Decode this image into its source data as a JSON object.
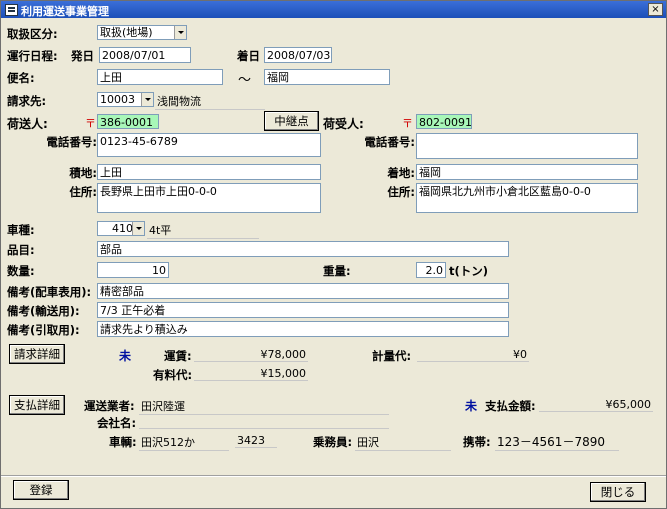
{
  "window": {
    "title": "利用運送事業管理",
    "close_glyph": "×",
    "icon": "form-icon"
  },
  "header": {
    "toriatsukai_label": "取扱区分:",
    "toriatsukai_value": "取扱(地場)",
    "schedule_label": "運行日程:",
    "departure_label": "発日",
    "departure_value": "2008/07/01",
    "arrival_label": "着日",
    "arrival_value": "2008/07/03",
    "binmei_label": "便名:",
    "binmei_from": "上田",
    "tilde": "～",
    "binmei_to": "福岡",
    "seikyu_label": "請求先:",
    "seikyu_code": "10003",
    "seikyu_name": "浅間物流"
  },
  "shipper": {
    "label": "荷送人:",
    "postal_mark": "〒",
    "postal": "386-0001",
    "phone_label": "電話番号:",
    "phone": "0123-45-6789",
    "load_label": "積地:",
    "load": "上田",
    "address_label": "住所:",
    "address": "長野県上田市上田0-0-0"
  },
  "relay_button": "中継点",
  "consignee": {
    "label": "荷受人:",
    "postal_mark": "〒",
    "postal": "802-0091",
    "phone_label": "電話番号:",
    "phone": "",
    "unload_label": "着地:",
    "unload": "福岡",
    "address_label": "住所:",
    "address": "福岡県北九州市小倉北区藍島0-0-0"
  },
  "cargo": {
    "vehicle_label": "車種:",
    "vehicle_code": "410",
    "vehicle_name": "4t平",
    "item_label": "品目:",
    "item": "部品",
    "qty_label": "数量:",
    "qty": "10",
    "weight_label": "重量:",
    "weight": "2.0",
    "weight_unit": "t(トン)",
    "note1_label": "備考(配車表用):",
    "note1": "精密部品",
    "note2_label": "備考(輸送用):",
    "note2": "7/3  正午必着",
    "note3_label": "備考(引取用):",
    "note3": "請求先より積込み"
  },
  "billing": {
    "button": "請求詳細",
    "status": "未",
    "fare_label": "運賃:",
    "fare": "¥78,000",
    "toll_label": "有料代:",
    "toll": "¥15,000",
    "meter_label": "計量代:",
    "meter": "¥0"
  },
  "payment": {
    "button": "支払詳細",
    "carrier_label": "運送業者:",
    "carrier": "田沢陸運",
    "company_label": "会社名:",
    "company": "",
    "status": "未",
    "amount_label": "支払金額:",
    "amount": "¥65,000",
    "vehicle_label": "車輌:",
    "vehicle": "田沢512か",
    "vehicle_no": "3423",
    "crew_label": "乗務員:",
    "crew": "田沢",
    "mobile_label": "携帯:",
    "mobile": "123－4561－7890"
  },
  "footer": {
    "register_button": "登録",
    "close_button": "閉じる"
  }
}
